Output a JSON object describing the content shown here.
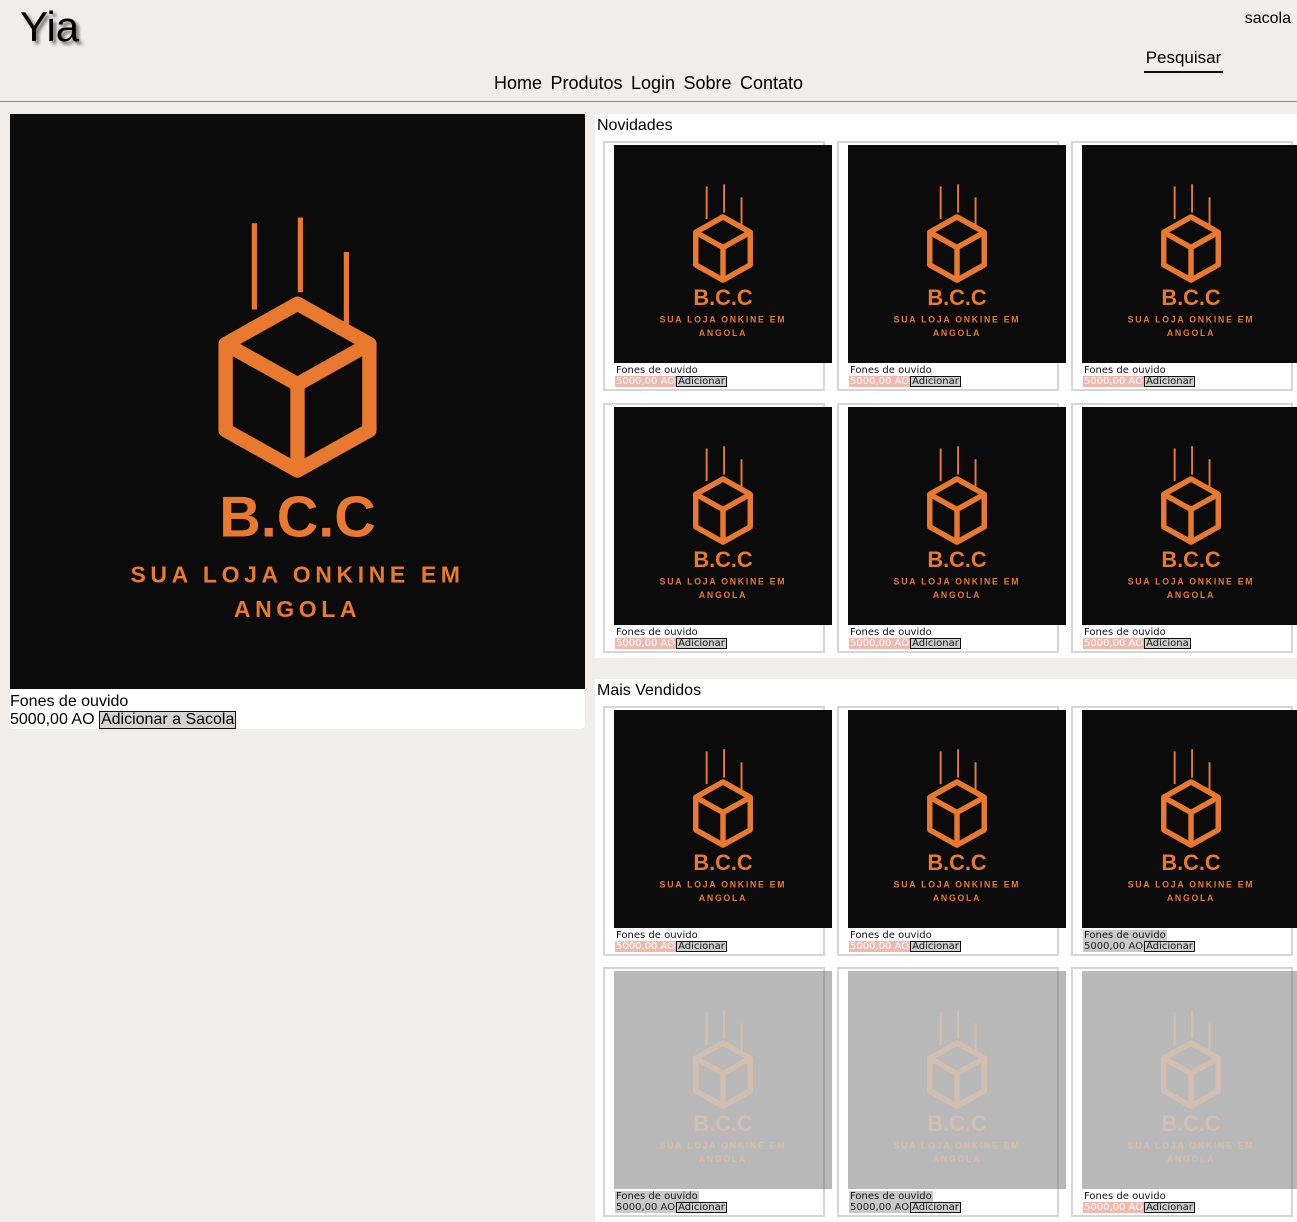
{
  "header": {
    "brand": "Yia",
    "cart_label": "sacola",
    "search_label": "Pesquisar",
    "nav": [
      "Home",
      "Produtos",
      "Login",
      "Sobre",
      "Contato"
    ]
  },
  "logo_art": {
    "name": "B.C.C",
    "tagline_1": "SUA LOJA ONKINE EM",
    "tagline_2": "ANGOLA",
    "color": "#e8792f",
    "background": "#0b0b0b"
  },
  "featured": {
    "title": "Fones de ouvido",
    "price": "5000,00 AO",
    "add_label": "Adicionar a Sacola"
  },
  "novidades": {
    "title": "Novidades",
    "products": [
      {
        "title": "Fones de ouvido",
        "price": "5000,00 AO",
        "add_label": "Adicionar"
      },
      {
        "title": "Fones de ouvido",
        "price": "5000,00 AO",
        "add_label": "Adicionar"
      },
      {
        "title": "Fones de ouvido",
        "price": "5000,00 AO",
        "add_label": "Adicionar"
      },
      {
        "title": "Fones de ouvido",
        "price": "5000,00 AO",
        "add_label": "Adicionar"
      },
      {
        "title": "Fones de ouvido",
        "price": "5000,00 AO",
        "add_label": "Adicionar"
      },
      {
        "title": "Fones de ouvido",
        "price": "5000,00 AO",
        "add_label": "Adiciona"
      }
    ]
  },
  "mais_vendidos": {
    "title": "Mais Vendidos",
    "products": [
      {
        "title": "Fones de ouvido",
        "price": "5000,00 AO",
        "add_label": "Adicionar"
      },
      {
        "title": "Fones de ouvido",
        "price": "5000,00 AO",
        "add_label": "Adicionar"
      },
      {
        "title": "Fones de ouvido",
        "price": "5000,00 AO",
        "add_label": "Adicionar"
      },
      {
        "title": "Fones de ouvido",
        "price": "5000,00 AO",
        "add_label": "Adicionar"
      },
      {
        "title": "Fones de ouvido",
        "price": "5000,00 AO",
        "add_label": "Adicionar"
      },
      {
        "title": "Fones de ouvido",
        "price": "5000,00 AO",
        "add_label": "Adicionar"
      }
    ]
  }
}
